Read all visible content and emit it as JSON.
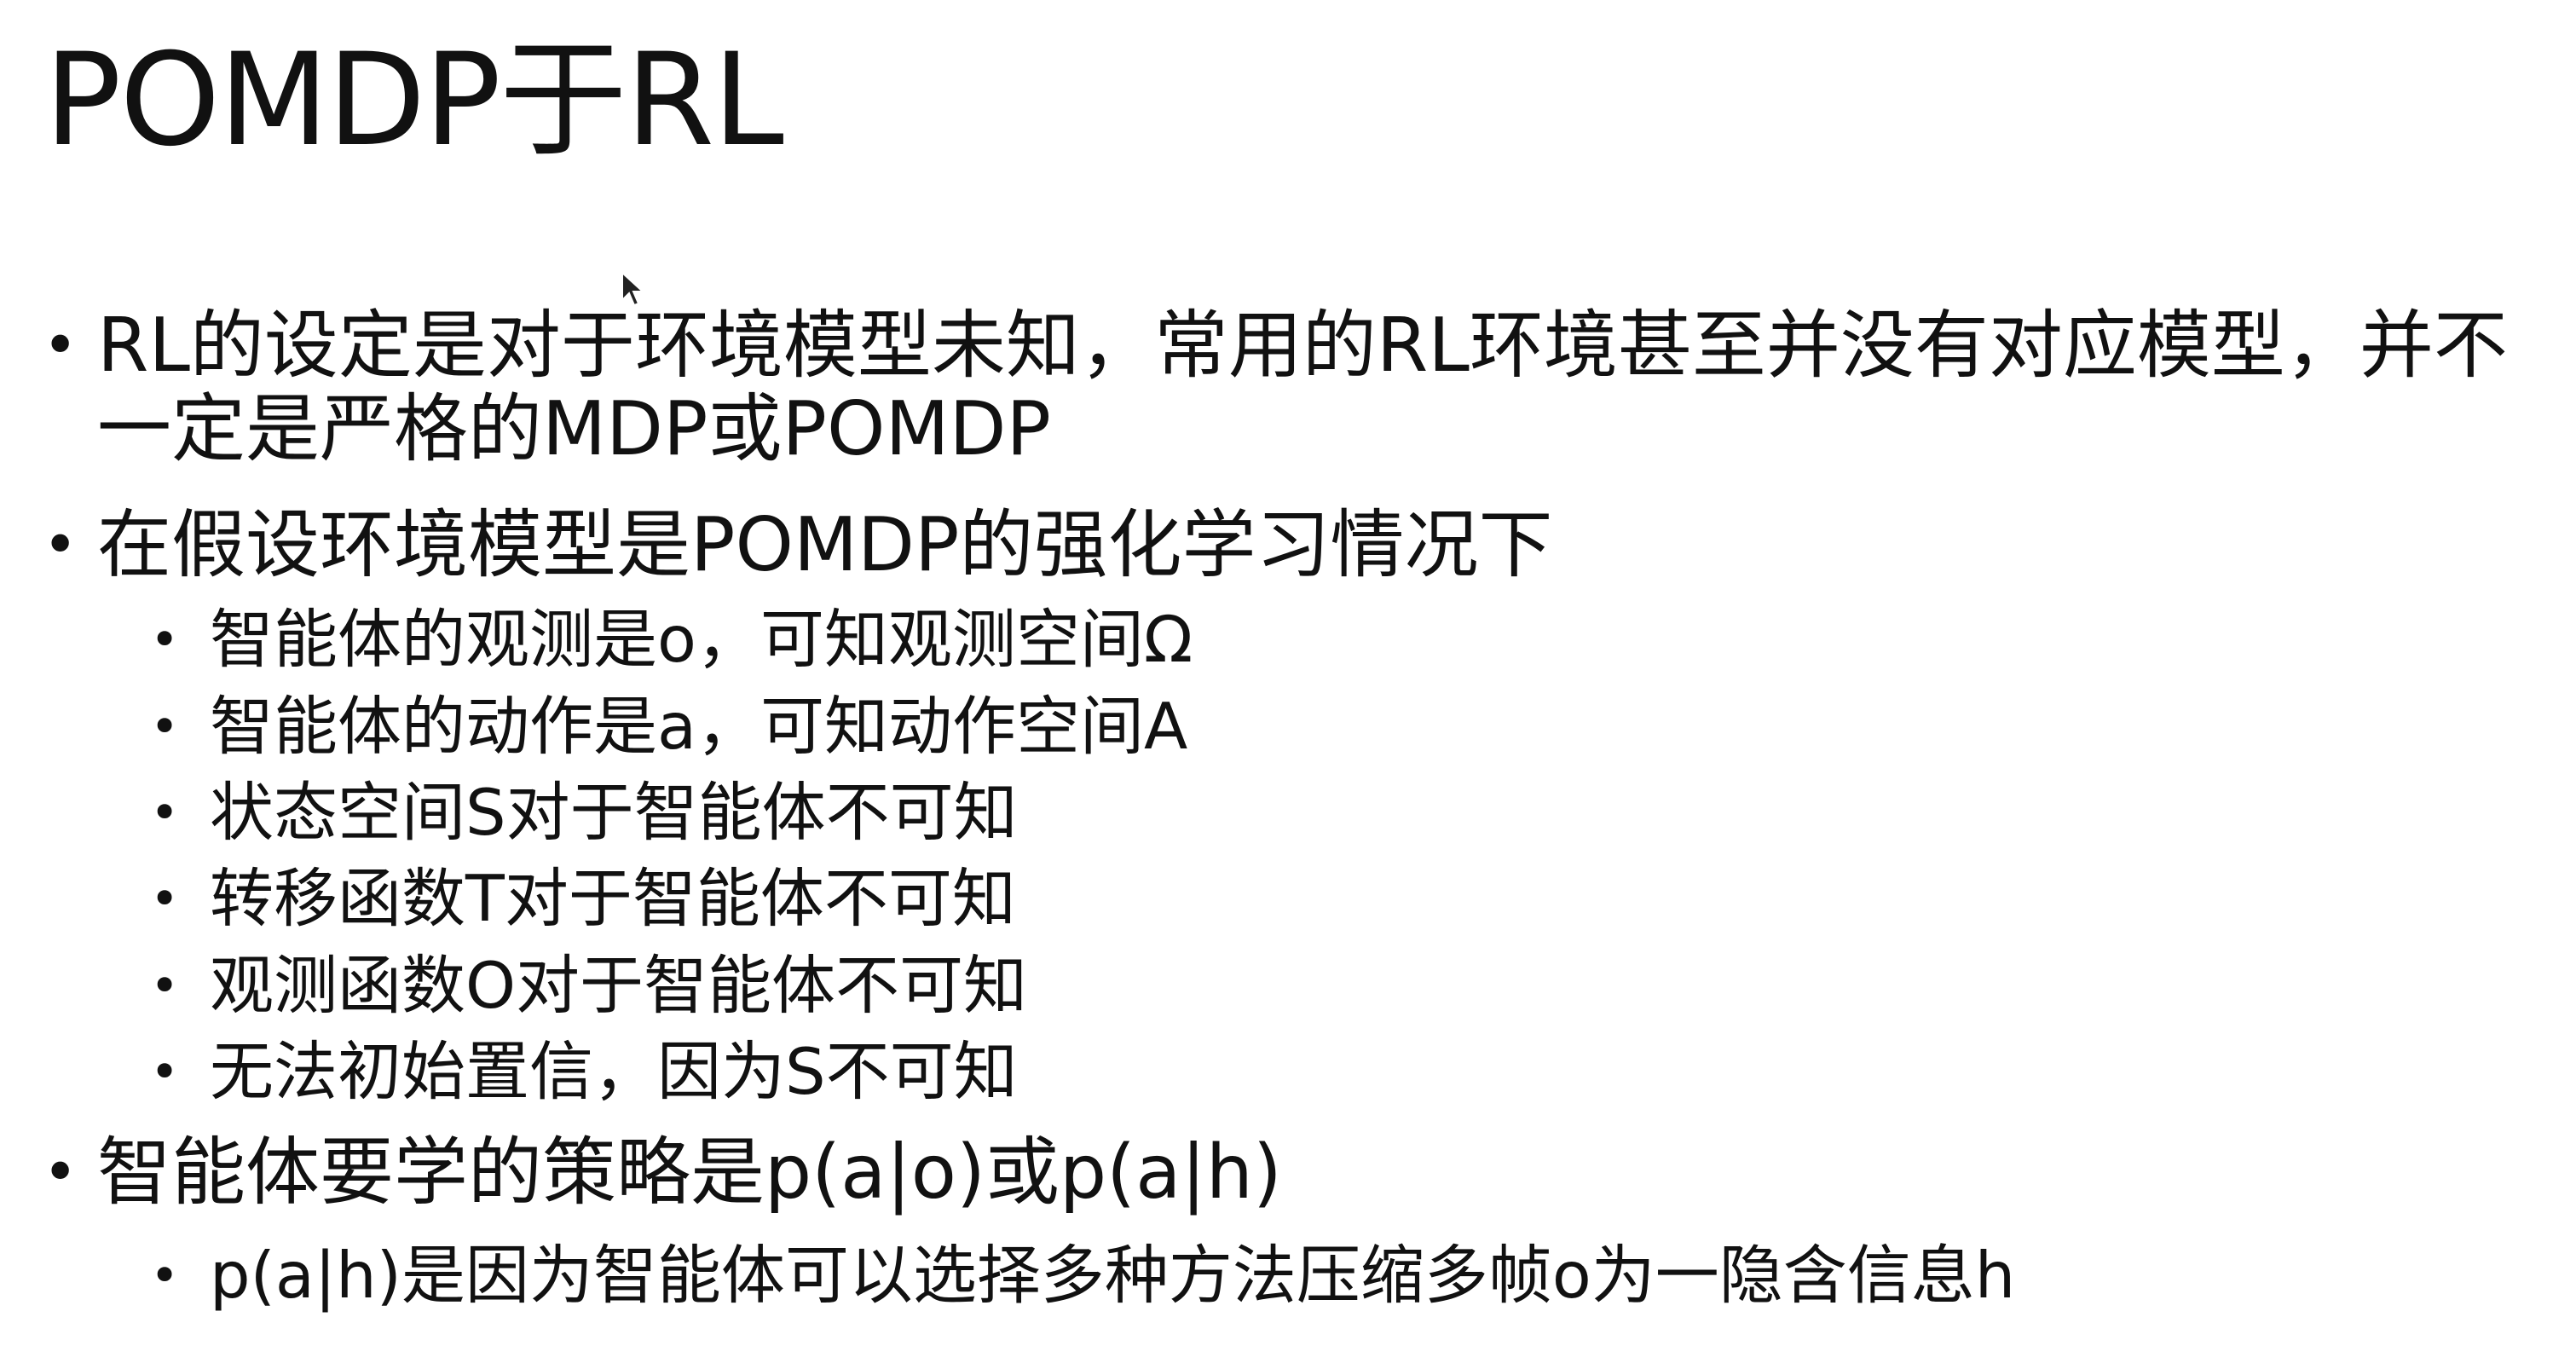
{
  "slide": {
    "title": "POMDP于RL",
    "bullet_char": "•",
    "bullets": [
      {
        "text": "RL的设定是对于环境模型未知，常用的RL环境甚至并没有对应模型，并不一定是严格的MDP或POMDP"
      },
      {
        "text": "在假设环境模型是POMDP的强化学习情况下",
        "sub": [
          "智能体的观测是o，可知观测空间Ω",
          "智能体的动作是a，可知动作空间A",
          "状态空间S对于智能体不可知",
          "转移函数T对于智能体不可知",
          "观测函数O对于智能体不可知",
          "无法初始置信，因为S不可知"
        ]
      },
      {
        "text": "智能体要学的策略是p(a|o)或p(a|h)",
        "sub": [
          "p(a|h)是因为智能体可以选择多种方法压缩多帧o为一隐含信息h"
        ]
      }
    ]
  }
}
